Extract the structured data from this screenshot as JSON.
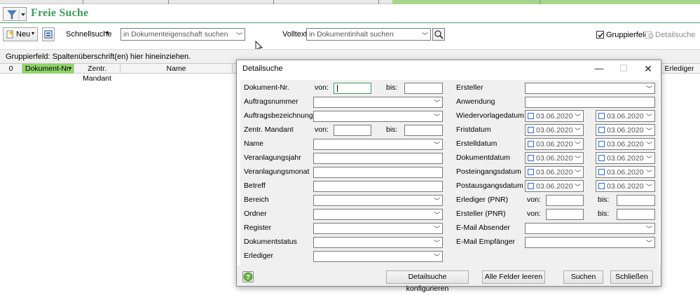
{
  "page": {
    "title": "Freie Suche"
  },
  "toolbar": {
    "new_label": "Neu",
    "quick_search_label": "Schnellsuche",
    "quick_search_placeholder": "in Dokumenteigenschaft suchen",
    "fulltext_label": "Volltext",
    "fulltext_placeholder": "in Dokumentinhalt suchen",
    "group_field_label": "Gruppierfeld",
    "group_field_checked": true,
    "detail_search_label": "Detailsuche"
  },
  "group_bar": {
    "hint": "Gruppierfeld: Spaltenüberschrift(en) hier hineinziehen."
  },
  "grid": {
    "columns": [
      "0",
      "Dokument-Nr.",
      "Zentr. Mandant",
      "Name",
      "Erlediger"
    ]
  },
  "dialog": {
    "title": "Detailsuche",
    "von": "von:",
    "bis": "bis:",
    "left_fields": [
      "Dokument-Nr.",
      "Auftragsnummer",
      "Auftragsbezeichnung",
      "Zentr. Mandant",
      "Name",
      "Veranlagungsjahr",
      "Veranlagungsmonat",
      "Betreff",
      "Bereich",
      "Ordner",
      "Register",
      "Dokumentstatus",
      "Erlediger"
    ],
    "right_fields": [
      "Ersteller",
      "Anwendung",
      "Wiedervorlagedatum",
      "Fristdatum",
      "Erstelldatum",
      "Dokumentdatum",
      "Posteingangsdatum",
      "Postausgangsdatum",
      "Erlediger (PNR)",
      "Ersteller (PNR)",
      "E-Mail Absender",
      "E-Mail Empfänger"
    ],
    "date_value": "03.06.2020",
    "buttons": {
      "configure": "Detailsuche konfigurieren",
      "clear": "Alle Felder leeren",
      "search": "Suchen",
      "close": "Schließen"
    }
  },
  "colors": {
    "accent_green": "#3d9b5a",
    "checkbox_blue": "#2a6cc8",
    "header_green": "#8fd46a"
  }
}
